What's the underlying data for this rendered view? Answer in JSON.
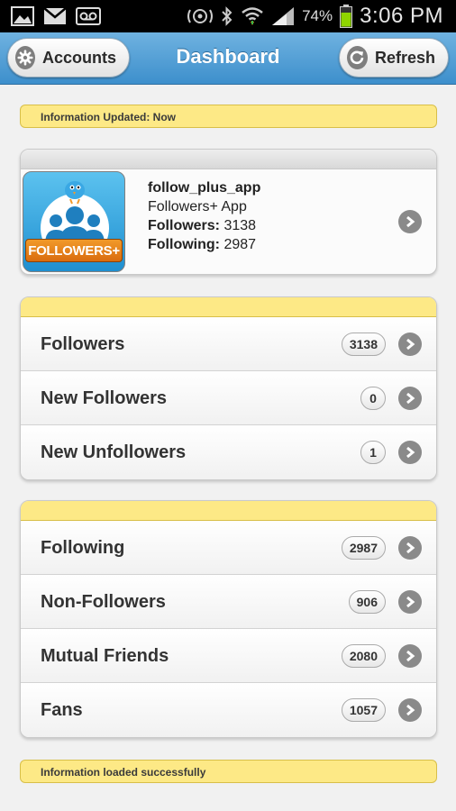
{
  "status_bar": {
    "battery_percent": "74%",
    "time": "3:06 PM",
    "icons": [
      "gallery-icon",
      "gmail-icon",
      "voicemail-icon",
      "nfc-icon",
      "bluetooth-icon",
      "wifi-icon",
      "signal-icon",
      "battery-icon"
    ]
  },
  "header": {
    "title": "Dashboard",
    "accounts_label": "Accounts",
    "refresh_label": "Refresh",
    "accent": "#3d8fcc"
  },
  "info_top": "Information Updated: Now",
  "profile": {
    "username": "follow_plus_app",
    "app_name": "Followers+ App",
    "followers_label": "Followers:",
    "followers_value": "3138",
    "following_label": "Following:",
    "following_value": "2987",
    "icon_text": "FOLLOWERS+"
  },
  "group1": [
    {
      "label": "Followers",
      "count": "3138"
    },
    {
      "label": "New Followers",
      "count": "0"
    },
    {
      "label": "New Unfollowers",
      "count": "1"
    }
  ],
  "group2": [
    {
      "label": "Following",
      "count": "2987"
    },
    {
      "label": "Non-Followers",
      "count": "906"
    },
    {
      "label": "Mutual Friends",
      "count": "2080"
    },
    {
      "label": "Fans",
      "count": "1057"
    }
  ],
  "info_bottom": "Information loaded successfully",
  "colors": {
    "info_yellow": "#fde986",
    "chevron_grey": "#8a8a8a"
  }
}
